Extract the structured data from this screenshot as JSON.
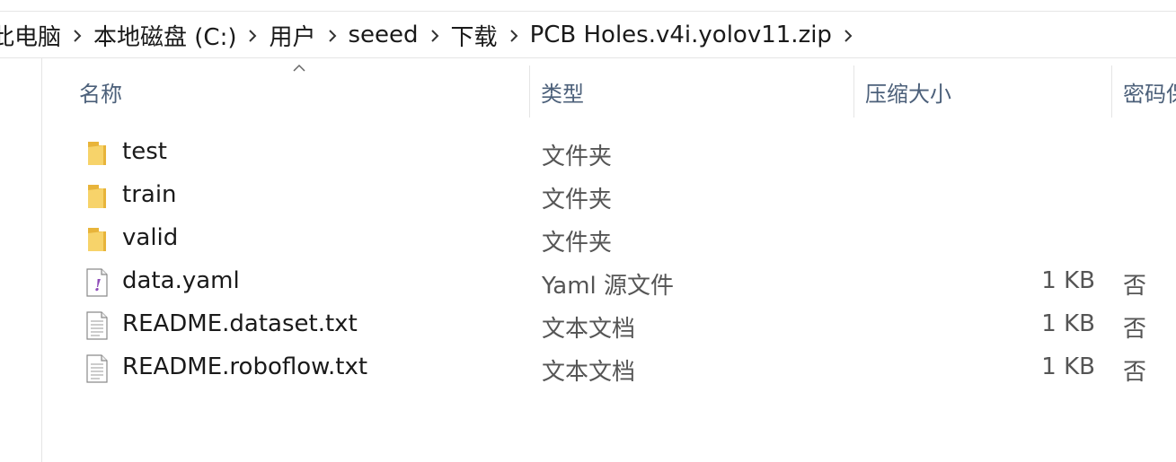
{
  "breadcrumb": [
    {
      "label": "此电脑"
    },
    {
      "label": "本地磁盘 (C:)"
    },
    {
      "label": "用户"
    },
    {
      "label": "seeed"
    },
    {
      "label": "下载"
    },
    {
      "label": "PCB Holes.v4i.yolov11.zip"
    }
  ],
  "columns": {
    "name": "名称",
    "type": "类型",
    "compressed_size": "压缩大小",
    "password": "密码保"
  },
  "files": [
    {
      "name": "test",
      "type": "文件夹",
      "size": "",
      "password": "",
      "icon": "folder-icon"
    },
    {
      "name": "train",
      "type": "文件夹",
      "size": "",
      "password": "",
      "icon": "folder-icon"
    },
    {
      "name": "valid",
      "type": "文件夹",
      "size": "",
      "password": "",
      "icon": "folder-icon"
    },
    {
      "name": "data.yaml",
      "type": "Yaml 源文件",
      "size": "1 KB",
      "password": "否",
      "icon": "yaml-file-icon"
    },
    {
      "name": "README.dataset.txt",
      "type": "文本文档",
      "size": "1 KB",
      "password": "否",
      "icon": "text-file-icon"
    },
    {
      "name": "README.roboflow.txt",
      "type": "文本文档",
      "size": "1 KB",
      "password": "否",
      "icon": "text-file-icon"
    }
  ],
  "colors": {
    "folder": "#f3c74b",
    "header_text": "#4c607a",
    "divider": "#e5e5e5"
  }
}
